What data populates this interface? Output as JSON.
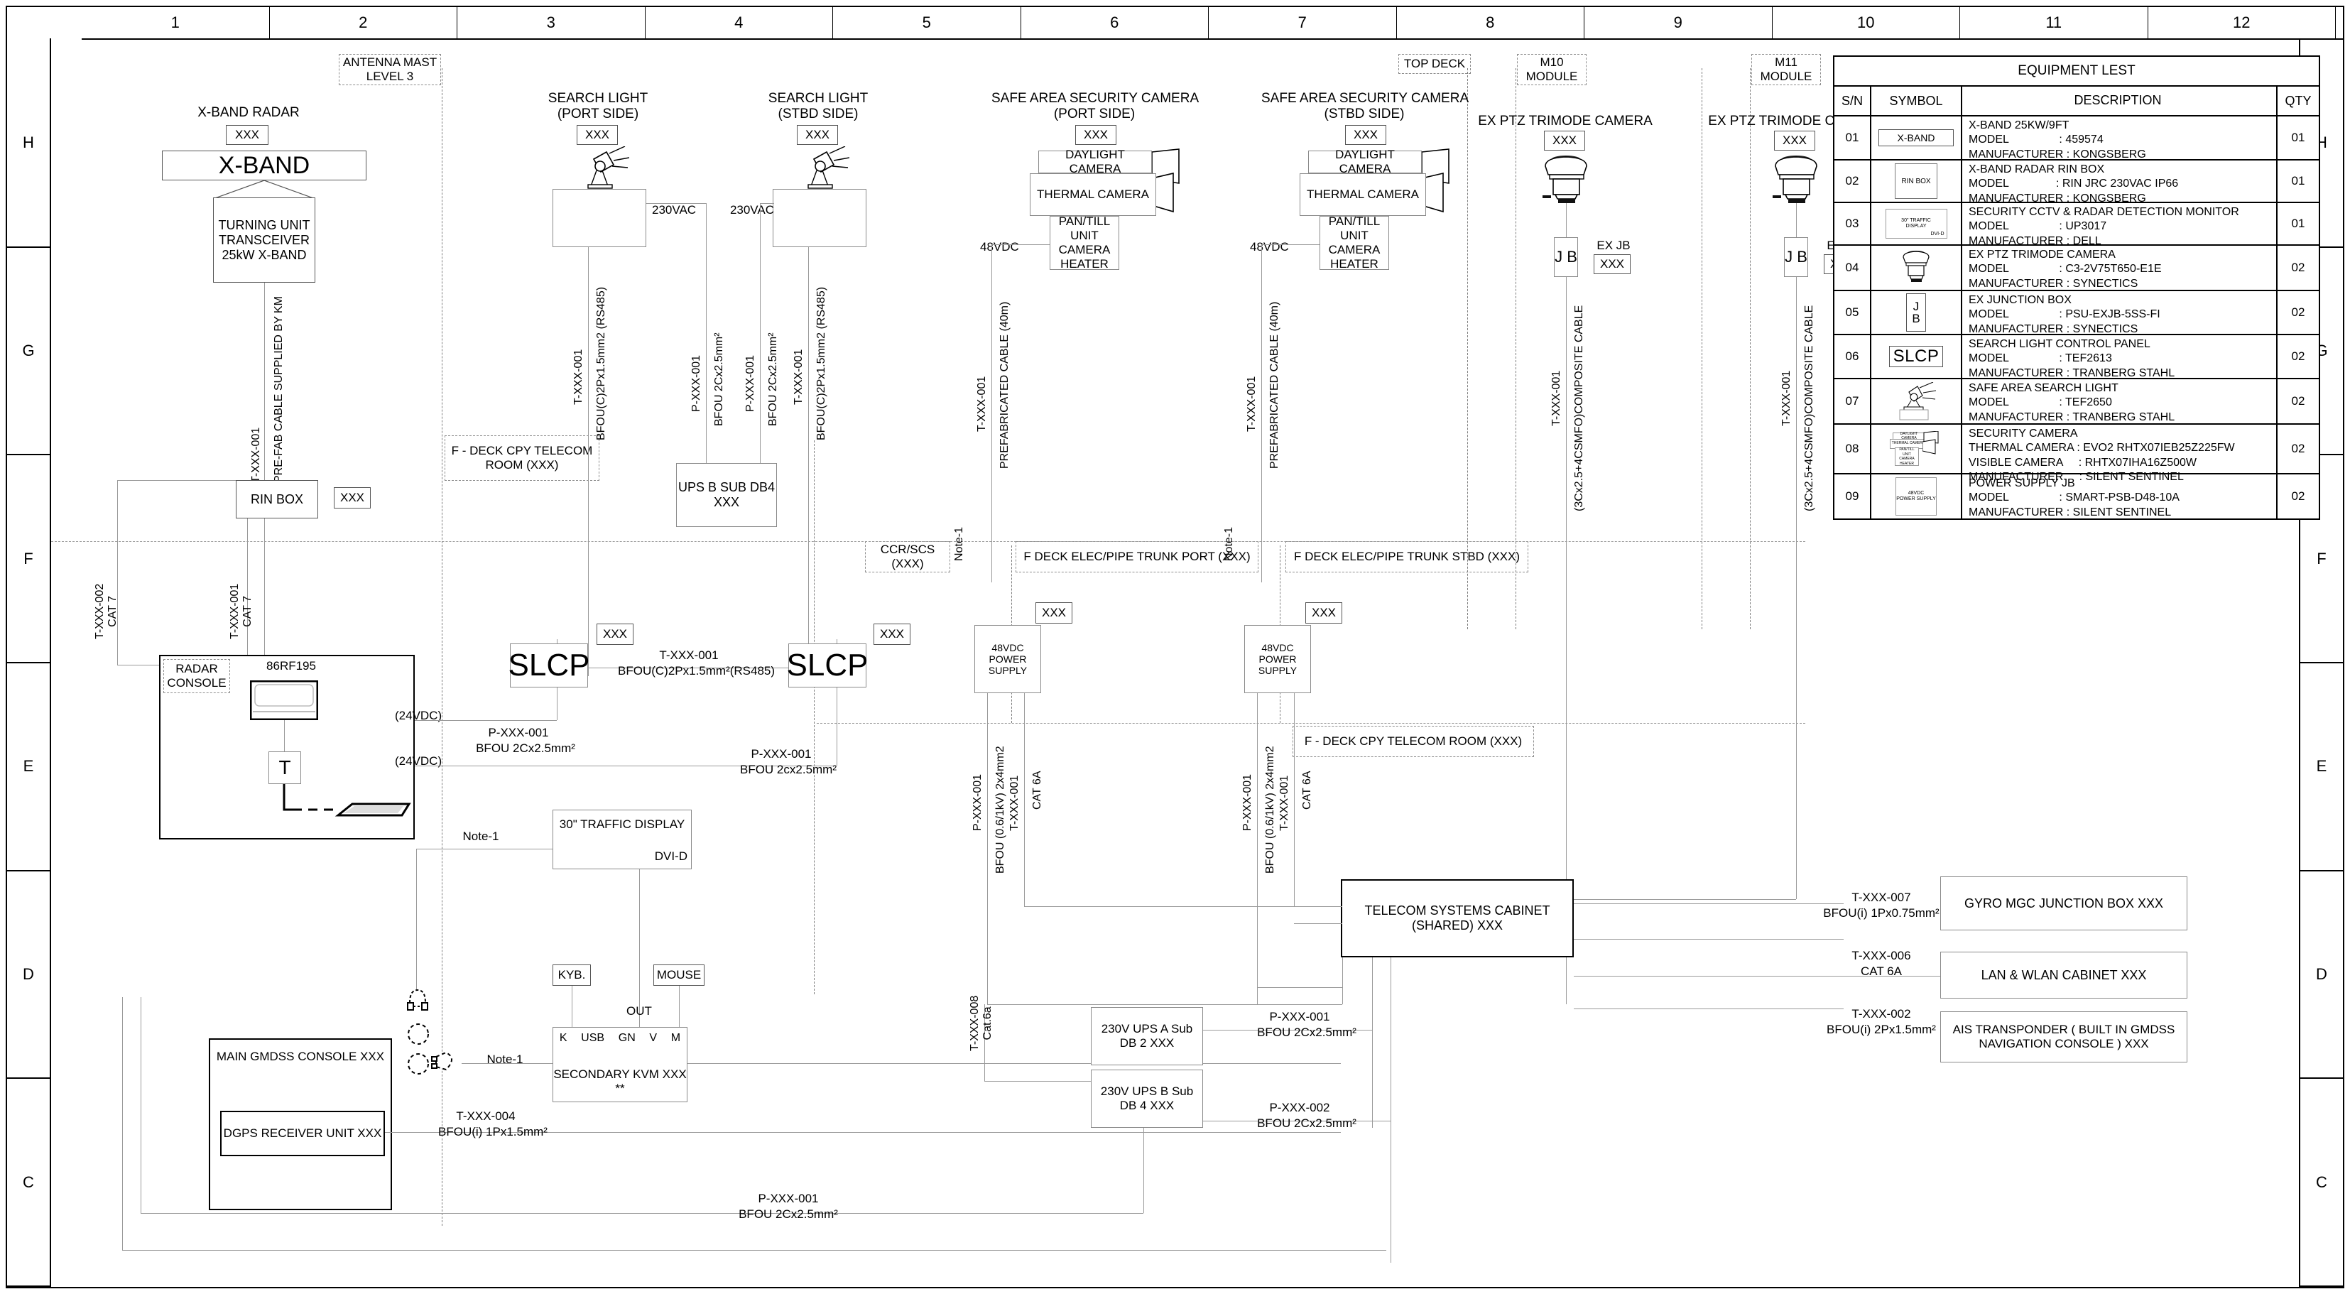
{
  "sheet": {
    "columns": [
      "1",
      "2",
      "3",
      "4",
      "5",
      "6",
      "7",
      "8",
      "9",
      "10",
      "11",
      "12"
    ],
    "rows": [
      "H",
      "G",
      "F",
      "E",
      "D",
      "C"
    ]
  },
  "zones": {
    "antenna_mast": "ANTENNA MAST\nLEVEL 3",
    "top_deck": "TOP DECK",
    "m10_module": "M10\nMODULE",
    "m11_module": "M11\nMODULE",
    "f_deck_cpy_left": "F - DECK\nCPY TELECOM ROOM\n(XXX)",
    "ccr_scs": "CCR/SCS\n(XXX)",
    "f_deck_trunk_port": "F DECK\nELEC/PIPE TRUNK PORT (XXX)",
    "f_deck_trunk_stbd": "F DECK\nELEC/PIPE TRUNK STBD (XXX)",
    "f_deck_cpy_right": "F - DECK\nCPY TELECOM ROOM (XXX)"
  },
  "nodes": {
    "xband_radar_title": "X-BAND RADAR",
    "xband_radar_tag": "XXX",
    "xband_label": "X-BAND",
    "turning_unit": "TURNING UNIT\nTRANSCEIVER\n25kW X-BAND",
    "rin_box": "RIN BOX",
    "rin_box_tag": "XXX",
    "radar_console": "RADAR\nCONSOLE",
    "radar_console_model": "86RF195",
    "radar_t": "T",
    "search_light_port_title": "SEARCH LIGHT\n(PORT SIDE)",
    "search_light_port_tag": "XXX",
    "search_light_stbd_title": "SEARCH LIGHT\n(STBD SIDE)",
    "search_light_stbd_tag": "XXX",
    "ups_b_sub_db4": "UPS B\nSUB DB4\nXXX",
    "slcp_left": "SLCP",
    "slcp_left_tag": "XXX",
    "slcp_right": "SLCP",
    "slcp_right_tag": "XXX",
    "safe_cam_port_title": "SAFE AREA SECURITY CAMERA\n(PORT SIDE)",
    "safe_cam_port_tag": "XXX",
    "safe_cam_stbd_title": "SAFE AREA SECURITY CAMERA\n(STBD SIDE)",
    "safe_cam_stbd_tag": "XXX",
    "daylight_camera": "DAYLIGHT CAMERA",
    "thermal_camera": "THERMAL CAMERA",
    "pan_till_unit": "PAN/TILL\nUNIT\nCAMERA\nHEATER",
    "psu_port_tag": "XXX",
    "psu_stbd_tag": "XXX",
    "psu_label": "48VDC\nPOWER SUPPLY",
    "ptz_port_title": "EX PTZ TRIMODE CAMERA",
    "ptz_port_tag": "XXX",
    "ptz_stbd_title": "EX PTZ TRIMODE CAMERA",
    "ptz_stbd_tag": "XXX",
    "ex_jb_label": "J\nB",
    "ex_jb_port_title": "EX JB",
    "ex_jb_port_tag": "XXX",
    "ex_jb_stbd_title": "EX JB",
    "ex_jb_stbd_tag": "XXX",
    "traffic_display": "30\" TRAFFIC\nDISPLAY",
    "traffic_display_port": "DVI-D",
    "kyb": "KYB.",
    "mouse": "MOUSE",
    "kvm_out": "OUT",
    "kvm_ports": [
      "K",
      "USB",
      "GN",
      "V",
      "M"
    ],
    "secondary_kvm": "SECONDARY KVM\nXXX\n**",
    "main_gmdss_console": "MAIN GMDSS CONSOLE\nXXX",
    "dgps_receiver": "DGPS RECEIVER UNIT\nXXX",
    "telecom_cabinet": "TELECOM SYSTEMS CABINET (SHARED)\nXXX",
    "ups_a": "230V UPS A\nSub DB 2\nXXX",
    "ups_b": "230V UPS B\nSub DB 4\nXXX",
    "gyro_jb": "GYRO\nMGC JUNCTION BOX\nXXX",
    "lan_wlan": "LAN & WLAN CABINET\nXXX",
    "ais": "AIS TRANSPONDER\n( BUILT IN GMDSS NAVIGATION CONSOLE )\nXXX"
  },
  "cables": {
    "prefab_km": "PRE-FAB CABLE SUPPLIED BY KM",
    "t001_a": "T-XXX-001",
    "t002_cat7": "T-XXX-002\nCAT 7",
    "t001_cat7": "T-XXX-001\nCAT 7",
    "sl_rs485": "BFOU(C)2Px1.5mm2  (RS485)",
    "sl_rs485_b": "BFOU(C)2Px1.5mm2 (RS485)",
    "p001": "P-XXX-001",
    "p002": "P-XXX-002",
    "bfou_2cx25": "BFOU 2Cx2.5mm²",
    "bfou_2cx25_lc": "BFOU 2cx2.5mm²",
    "v230": "230VAC",
    "v48": "48VDC",
    "v24": "(24VDC)",
    "prefab_40m": "PREFABRICATED CABLE (40m)",
    "note1": "Note-1",
    "slcp_link": "T-XXX-001\nBFOU(C)2Px1.5mm²(RS485)",
    "bfou_2x4": "BFOU (0.6/1kV) 2x4mm2",
    "cat6a": "CAT 6A",
    "composite": "(3Cx2.5+4CSMFO)COMPOSITE CABLE",
    "t008_cat6a": "T-XXX-008\nCat.6a",
    "t007": "T-XXX-007",
    "bfou_1px075": "BFOU(i) 1Px0.75mm²",
    "t006": "T-XXX-006",
    "t002": "T-XXX-002",
    "bfou_2px15": "BFOU(i) 2Px1.5mm²",
    "t004": "T-XXX-004",
    "bfou_1px15": "BFOU(i) 1Px1.5mm²"
  },
  "equipment_list": {
    "title": "EQUIPMENT LEST",
    "headers": [
      "S/N",
      "SYMBOL",
      "DESCRIPTION",
      "QTY"
    ],
    "rows": [
      {
        "sn": "01",
        "symbol": "x-band-symbol",
        "symbol_text": "X-BAND",
        "desc": [
          "X-BAND 25KW/9FT",
          "MODEL                : 459574",
          "MANUFACTURER : KONGSBERG"
        ],
        "qty": "01"
      },
      {
        "sn": "02",
        "symbol": "rin-box-symbol",
        "symbol_text": "RIN BOX",
        "desc": [
          "X-BAND RADAR RIN BOX",
          "MODEL               : RIN JRC 230VAC IP66",
          "MANUFACTURER : KONGSBERG"
        ],
        "qty": "01"
      },
      {
        "sn": "03",
        "symbol": "monitor-symbol",
        "symbol_text": "30\" TRAFFIC\nDISPLAY",
        "symbol_sub": "DVI-D",
        "desc": [
          "SECURITY CCTV & RADAR DETECTION MONITOR",
          "MODEL                : UP3017",
          "MANUFACTURER : DELL"
        ],
        "qty": "01"
      },
      {
        "sn": "04",
        "symbol": "ptz-camera-symbol",
        "symbol_text": "",
        "desc": [
          "EX PTZ TRIMODE CAMERA",
          "MODEL                : C3-2V75T650-E1E",
          "MANUFACTURER : SYNECTICS"
        ],
        "qty": "02"
      },
      {
        "sn": "05",
        "symbol": "junction-box-symbol",
        "symbol_text": "J B",
        "desc": [
          "EX JUNCTION BOX",
          "MODEL                : PSU-EXJB-5SS-FI",
          "MANUFACTURER : SYNECTICS"
        ],
        "qty": "02"
      },
      {
        "sn": "06",
        "symbol": "slcp-symbol",
        "symbol_text": "SLCP",
        "desc": [
          "SEARCH LIGHT CONTROL PANEL",
          "MODEL                : TEF2613",
          "MANUFACTURER : TRANBERG STAHL"
        ],
        "qty": "02"
      },
      {
        "sn": "07",
        "symbol": "search-light-symbol",
        "symbol_text": "",
        "desc": [
          "SAFE AREA SEARCH LIGHT",
          "MODEL                : TEF2650",
          "MANUFACTURER : TRANBERG STAHL"
        ],
        "qty": "02"
      },
      {
        "sn": "08",
        "symbol": "security-camera-symbol",
        "symbol_text": "",
        "desc": [
          "SECURITY CAMERA",
          "THERMAL CAMERA : EVO2 RHTX07IEB25Z225FW",
          "VISIBLE CAMERA     : RHTX07IHA16Z500W",
          "MANUFACTURER     : SILENT SENTINEL"
        ],
        "qty": "02"
      },
      {
        "sn": "09",
        "symbol": "power-supply-symbol",
        "symbol_text": "48VDC\nPOWER SUPPLY",
        "desc": [
          "POWER SUPPLY JB",
          "MODEL                : SMART-PSB-D48-10A",
          "MANUFACTURER : SILENT SENTINEL"
        ],
        "qty": "02"
      }
    ]
  }
}
